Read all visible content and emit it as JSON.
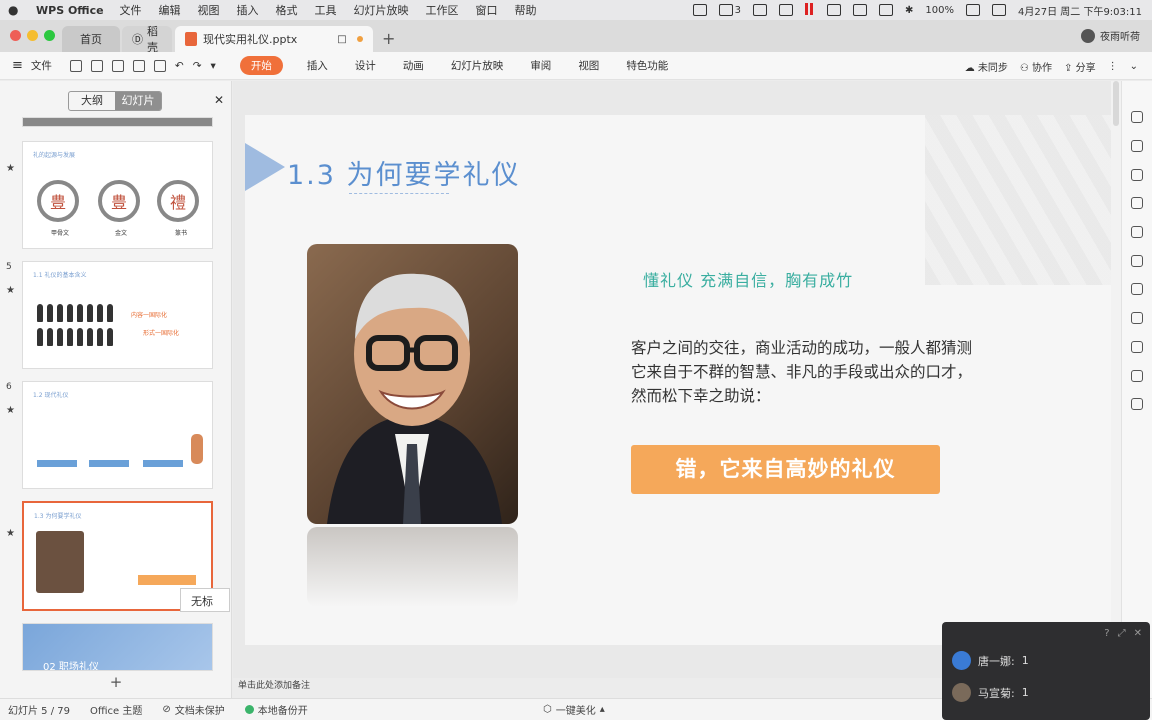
{
  "menubar": {
    "app_name": "WPS Office",
    "items": [
      "文件",
      "编辑",
      "视图",
      "插入",
      "格式",
      "工具",
      "幻灯片放映",
      "工作区",
      "窗口",
      "帮助"
    ],
    "badge_count": "3",
    "battery": "100%",
    "clock": "4月27日 周二 下午9:03:11"
  },
  "tabs": {
    "home": "首页",
    "shell": "稻壳",
    "document": "现代实用礼仪.pptx",
    "user_name": "夜雨听荷"
  },
  "ribbon": {
    "file": "文件",
    "tabs": [
      "开始",
      "插入",
      "设计",
      "动画",
      "幻灯片放映",
      "审阅",
      "视图",
      "特色功能"
    ],
    "active_tab": "开始",
    "sync": "未同步",
    "collab": "协作",
    "share": "分享"
  },
  "left_panel": {
    "tab_outline": "大纲",
    "tab_slides": "幻灯片",
    "thumb_numbers": [
      "5",
      "6"
    ],
    "thumb_titles": [
      "礼的起源与发展",
      "1.1 礼仪的基本含义",
      "1.2 现代礼仪",
      "1.3 为何要学礼仪",
      "02 职场礼仪"
    ],
    "thumb_circle_labels": [
      "豊",
      "豊",
      "禮"
    ],
    "thumb_circle_captions": [
      "甲骨文",
      "金文",
      "篆书"
    ],
    "thumb_side_labels": [
      "内容一国际化",
      "形式一国际化"
    ],
    "tooltip": "无标"
  },
  "slide": {
    "title": "1.3  为何要学礼仪",
    "subtitle": "懂礼仪   充满自信，胸有成竹",
    "body": "客户之间的交往，商业活动的成功，一般人都猜测它来自于不群的智慧、非凡的手段或出众的口才，然而松下幸之助说：",
    "cta": "错，它来自高妙的礼仪",
    "notes_placeholder": "单击此处添加备注"
  },
  "status": {
    "slide_counter": "幻灯片 5 / 79",
    "theme": "Office 主题",
    "protect": "文档未保护",
    "backup": "本地备份开",
    "beautify": "一键美化"
  },
  "chat": {
    "entries": [
      {
        "name": "唐一娜:",
        "value": "1"
      },
      {
        "name": "马宣菊:",
        "value": "1"
      }
    ]
  },
  "colors": {
    "accent": "#f0703a",
    "title_blue": "#5b8fcf",
    "cta_orange": "#f5a85a",
    "subtitle_teal": "#3aaea0"
  }
}
